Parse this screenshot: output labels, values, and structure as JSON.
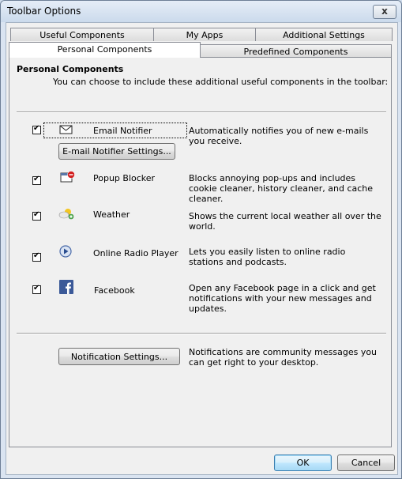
{
  "window": {
    "title": "Toolbar Options",
    "close_glyph": "x"
  },
  "tabs": {
    "row_back": [
      "Useful Components",
      "My Apps",
      "Additional Settings"
    ],
    "row_front": [
      "Personal Components",
      "Predefined Components"
    ],
    "active": "Personal Components"
  },
  "panel": {
    "section_title": "Personal Components",
    "section_desc": "You can choose to include these additional useful components in the toolbar:"
  },
  "components": [
    {
      "name": "Email Notifier",
      "icon": "envelope-icon",
      "checked": true,
      "description": "Automatically notifies you of new e-mails you receive."
    },
    {
      "name": "Popup Blocker",
      "icon": "popup-blocker-icon",
      "checked": true,
      "description": "Blocks annoying pop-ups and includes cookie cleaner, history cleaner, and cache cleaner."
    },
    {
      "name": "Weather",
      "icon": "weather-icon",
      "checked": true,
      "description": "Shows the current local weather all over the world."
    },
    {
      "name": "Online Radio Player",
      "icon": "play-icon",
      "checked": true,
      "description": "Lets you easily listen to online radio stations and podcasts."
    },
    {
      "name": "Facebook",
      "icon": "facebook-icon",
      "checked": true,
      "description": "Open any Facebook page in a click and get notifications with your new messages and updates."
    }
  ],
  "email_settings_button": "E-mail Notifier Settings...",
  "notification": {
    "button": "Notification Settings...",
    "description": "Notifications are community messages you can get right to your desktop."
  },
  "footer": {
    "ok": "OK",
    "cancel": "Cancel"
  }
}
